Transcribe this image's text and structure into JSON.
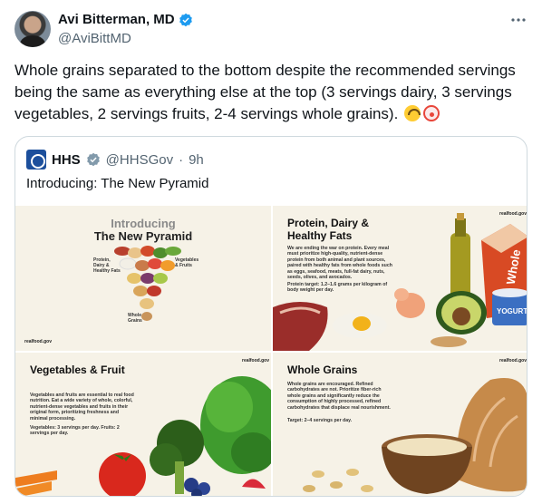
{
  "author": {
    "display_name": "Avi Bitterman, MD",
    "handle": "@AviBittMD"
  },
  "post": {
    "text": "Whole grains separated to the bottom despite the recommended servings being the same as everything else at the top (3 servings dairy, 3 servings vegetables, 2 servings fruits, 2-4 servings whole grains)."
  },
  "quote": {
    "display_name": "HHS",
    "handle": "@HHSGov",
    "separator": "·",
    "time": "9h",
    "text": "Introducing: The New Pyramid",
    "panels": {
      "pyramid": {
        "intro": "Introducing",
        "title": "The New Pyramid",
        "label_left": "Protein, Dairy & Healthy Fats",
        "label_right": "Vegetables & Fruits",
        "label_bottom": "Whole Grains",
        "brand": "realfood.gov"
      },
      "protein": {
        "title": "Protein, Dairy & Healthy Fats",
        "body": "We are ending the war on protein. Every meal must prioritize high-quality, nutrient-dense protein from both animal and plant sources, paired with healthy fats from whole foods such as eggs, seafood, meats, full-fat dairy, nuts, seeds, olives, and avocados.",
        "target": "Protein target: 1.2–1.6 grams per kilogram of body weight per day.",
        "brand": "realfood.gov",
        "carton_text": "Whole",
        "yogurt_text": "YOGURT"
      },
      "vegetables": {
        "title": "Vegetables & Fruit",
        "body": "Vegetables and fruits are essential to real food nutrition. Eat a wide variety of whole, colorful, nutrient-dense vegetables and fruits in their original form, prioritizing freshness and minimal processing.",
        "target": "Vegetables: 3 servings per day. Fruits: 2 servings per day.",
        "brand": "realfood.gov"
      },
      "grains": {
        "title": "Whole Grains",
        "body": "Whole grains are encouraged. Refined carbohydrates are not. Prioritize fiber-rich whole grains and significantly reduce the consumption of highly processed, refined carbohydrates that displace real nourishment.",
        "target": "Target: 2–4 servings per day.",
        "brand": "realfood.gov"
      }
    }
  },
  "icons": [
    "verified-badge-icon",
    "more-options-icon",
    "upside-down-face-emoji",
    "clown-face-emoji",
    "hhs-logo-icon"
  ],
  "colors": {
    "verified": "#1d9bf0",
    "text": "#0f1419",
    "secondary": "#536471",
    "border": "#cfd9de"
  }
}
